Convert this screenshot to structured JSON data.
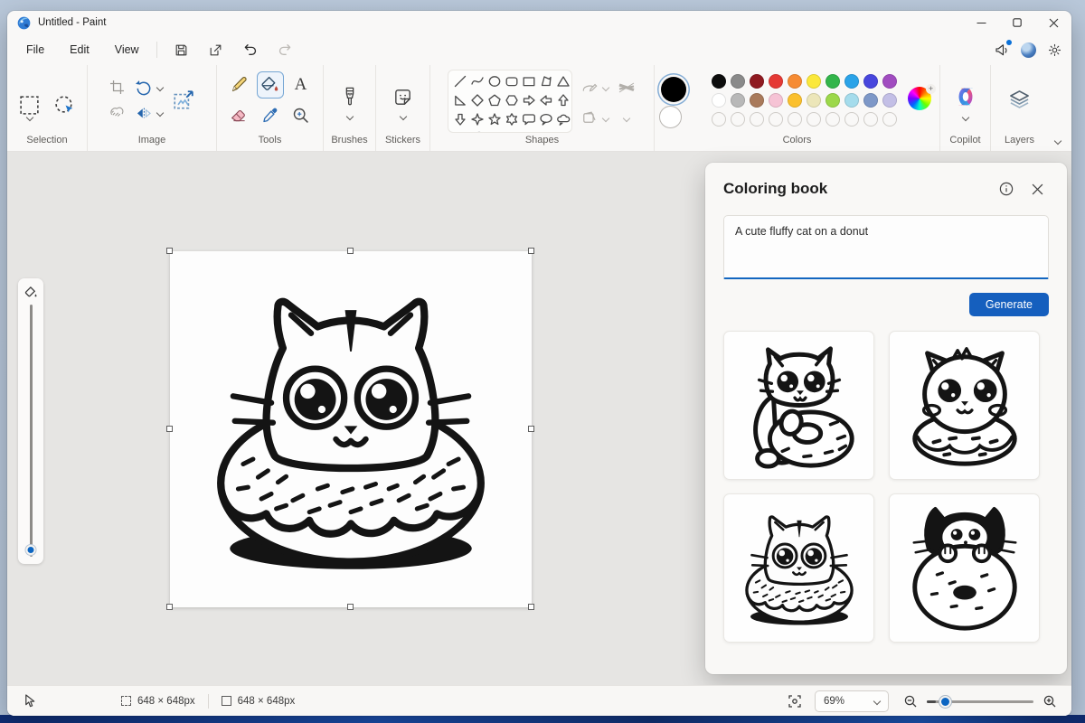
{
  "window": {
    "title": "Untitled - Paint"
  },
  "menu": {
    "file": "File",
    "edit": "Edit",
    "view": "View"
  },
  "ribbon": {
    "labels": {
      "selection": "Selection",
      "image": "Image",
      "tools": "Tools",
      "brushes": "Brushes",
      "stickers": "Stickers",
      "shapes": "Shapes",
      "colors": "Colors",
      "copilot": "Copilot",
      "layers": "Layers"
    }
  },
  "palette": {
    "primary": "#000000",
    "secondary": "#ffffff",
    "row1": [
      "#0d0d0d",
      "#8a8a8a",
      "#8f1a20",
      "#e53935",
      "#f68b33",
      "#fbe83a",
      "#33b54a",
      "#2ba3e8",
      "#4846dd",
      "#a14cc0"
    ],
    "row2": [
      "#ffffff",
      "#b8b8b8",
      "#a97a5b",
      "#f6c3d5",
      "#fbc02d",
      "#ece6b9",
      "#9cd84a",
      "#a5dcec",
      "#7e98c8",
      "#c3bfe6"
    ],
    "empty_count": 10
  },
  "panel": {
    "title": "Coloring book",
    "prompt": "A cute fluffy cat on a donut",
    "generate_label": "Generate"
  },
  "status": {
    "selection_size": "648 × 648px",
    "canvas_size": "648 × 648px",
    "zoom": "69%"
  },
  "colors": {
    "accent": "#155fbe",
    "selection_ring": "#86aed6",
    "ink": "#141414"
  }
}
